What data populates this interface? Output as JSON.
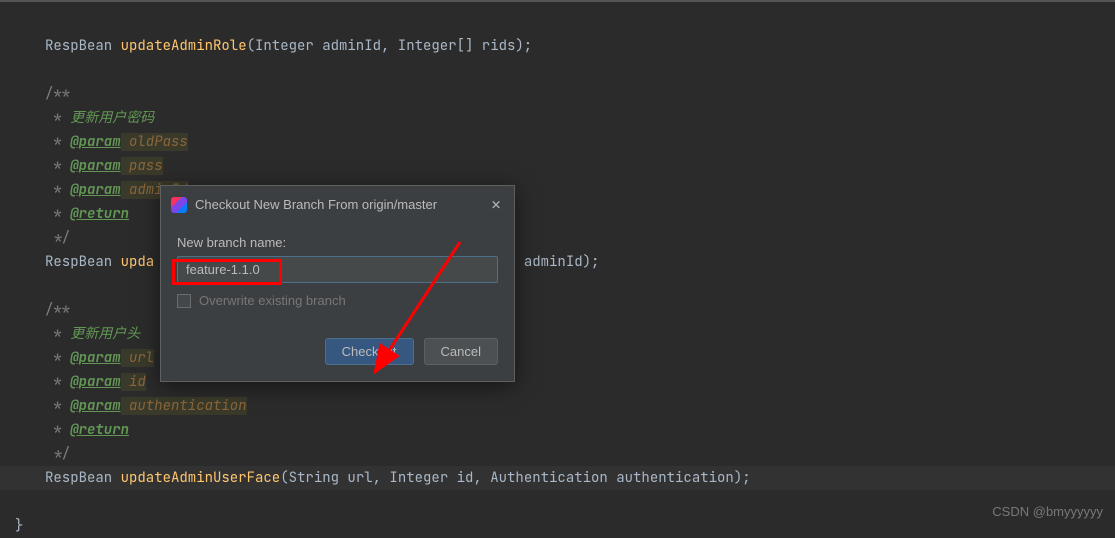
{
  "code": {
    "line1_ret": "RespBean ",
    "line1_method": "updateAdminRole",
    "line1_params": "(Integer adminId, Integer[] rids);",
    "doc1_open": "/**",
    "doc1_desc_star": " * ",
    "doc1_desc": "更新用户密码",
    "doc1_p1_star": " * ",
    "doc1_p1_tag": "@param",
    "doc1_p1_name": " oldPass",
    "doc1_p2_star": " * ",
    "doc1_p2_tag": "@param",
    "doc1_p2_name": " pass",
    "doc1_p3_star": " * ",
    "doc1_p3_tag": "@param",
    "doc1_p3_name": " adminId",
    "doc1_ret_star": " * ",
    "doc1_ret_tag": "@return",
    "doc1_close": " */",
    "line2_ret": "RespBean ",
    "line2_method": "upda",
    "line2_params_tail": " Integer adminId);",
    "doc2_open": "/**",
    "doc2_desc_star": " * ",
    "doc2_desc": "更新用户头",
    "doc2_p1_star": " * ",
    "doc2_p1_tag": "@param",
    "doc2_p1_name": " url",
    "doc2_p2_star": " * ",
    "doc2_p2_tag": "@param",
    "doc2_p2_name": " id",
    "doc2_p3_star": " * ",
    "doc2_p3_tag": "@param",
    "doc2_p3_name": " authentication",
    "doc2_ret_star": " * ",
    "doc2_ret_tag": "@return",
    "doc2_close": " */",
    "line3_ret": "RespBean ",
    "line3_method": "updateAdminUserFace",
    "line3_params": "(String url, Integer id, Authentication authentication);",
    "closing_brace": "}"
  },
  "dialog": {
    "title": "Checkout New Branch From origin/master",
    "label": "New branch name:",
    "input_value": "feature-1.1.0",
    "checkbox_label": "Overwrite existing branch",
    "btn_primary": "Checkout",
    "btn_cancel": "Cancel"
  },
  "watermark": "CSDN @bmyyyyyy"
}
